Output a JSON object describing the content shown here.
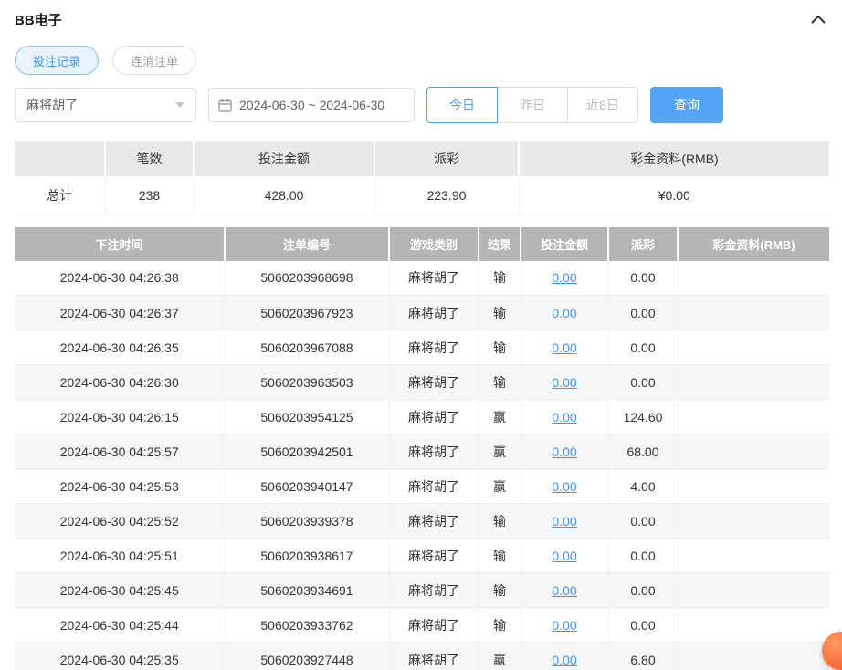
{
  "header": {
    "title": "BB电子"
  },
  "tabs": [
    {
      "label": "投注记录",
      "active": true
    },
    {
      "label": "连消注单",
      "active": false
    }
  ],
  "filters": {
    "game_select": {
      "value": "麻将胡了"
    },
    "date_range": "2024-06-30 ~ 2024-06-30",
    "quick_ranges": [
      {
        "label": "今日",
        "active": true
      },
      {
        "label": "昨日",
        "active": false
      },
      {
        "label": "近8日",
        "active": false
      }
    ],
    "search_label": "查询"
  },
  "summary": {
    "headers": [
      "",
      "笔数",
      "投注金额",
      "派彩",
      "彩金资料(RMB)"
    ],
    "row": {
      "label": "总计",
      "count": "238",
      "bet_amount": "428.00",
      "payout": "223.90",
      "bonus": "¥0.00"
    }
  },
  "table": {
    "headers": [
      "下注时间",
      "注单编号",
      "游戏类别",
      "结果",
      "投注金额",
      "派彩",
      "彩金资料(RMB)"
    ],
    "rows": [
      {
        "time": "2024-06-30 04:26:38",
        "order": "5060203968698",
        "game": "麻将胡了",
        "result": "输",
        "bet": "0.00",
        "payout": "0.00",
        "bonus": ""
      },
      {
        "time": "2024-06-30 04:26:37",
        "order": "5060203967923",
        "game": "麻将胡了",
        "result": "输",
        "bet": "0.00",
        "payout": "0.00",
        "bonus": ""
      },
      {
        "time": "2024-06-30 04:26:35",
        "order": "5060203967088",
        "game": "麻将胡了",
        "result": "输",
        "bet": "0.00",
        "payout": "0.00",
        "bonus": ""
      },
      {
        "time": "2024-06-30 04:26:30",
        "order": "5060203963503",
        "game": "麻将胡了",
        "result": "输",
        "bet": "0.00",
        "payout": "0.00",
        "bonus": ""
      },
      {
        "time": "2024-06-30 04:26:15",
        "order": "5060203954125",
        "game": "麻将胡了",
        "result": "赢",
        "bet": "0.00",
        "payout": "124.60",
        "bonus": ""
      },
      {
        "time": "2024-06-30 04:25:57",
        "order": "5060203942501",
        "game": "麻将胡了",
        "result": "赢",
        "bet": "0.00",
        "payout": "68.00",
        "bonus": ""
      },
      {
        "time": "2024-06-30 04:25:53",
        "order": "5060203940147",
        "game": "麻将胡了",
        "result": "赢",
        "bet": "0.00",
        "payout": "4.00",
        "bonus": ""
      },
      {
        "time": "2024-06-30 04:25:52",
        "order": "5060203939378",
        "game": "麻将胡了",
        "result": "输",
        "bet": "0.00",
        "payout": "0.00",
        "bonus": ""
      },
      {
        "time": "2024-06-30 04:25:51",
        "order": "5060203938617",
        "game": "麻将胡了",
        "result": "输",
        "bet": "0.00",
        "payout": "0.00",
        "bonus": ""
      },
      {
        "time": "2024-06-30 04:25:45",
        "order": "5060203934691",
        "game": "麻将胡了",
        "result": "输",
        "bet": "0.00",
        "payout": "0.00",
        "bonus": ""
      },
      {
        "time": "2024-06-30 04:25:44",
        "order": "5060203933762",
        "game": "麻将胡了",
        "result": "输",
        "bet": "0.00",
        "payout": "0.00",
        "bonus": ""
      },
      {
        "time": "2024-06-30 04:25:35",
        "order": "5060203927448",
        "game": "麻将胡了",
        "result": "赢",
        "bet": "0.00",
        "payout": "6.80",
        "bonus": ""
      }
    ]
  },
  "colors": {
    "accent_blue": "#54a4f8",
    "link_blue": "#3e97f0",
    "table_header_gray": "#b5b5b5",
    "float_button_orange": "#f4502a"
  },
  "icons": {
    "collapse": "chevron-up",
    "select": "chevron-down",
    "date": "calendar"
  }
}
